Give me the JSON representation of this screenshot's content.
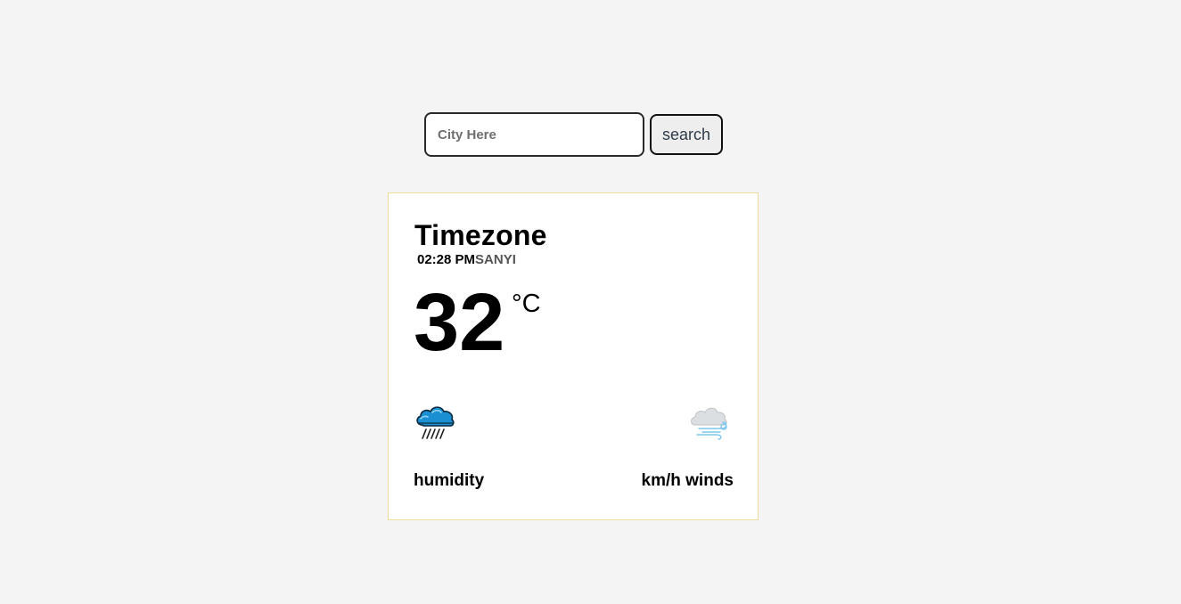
{
  "search": {
    "placeholder": "City Here",
    "value": "",
    "button_label": "search"
  },
  "card": {
    "title": "Timezone",
    "time": "02:28 PM",
    "timezone_abbr": "SANYI",
    "temperature": "32",
    "unit": "°C",
    "weather_icon": "rain-cloud-icon",
    "wind_icon": "wind-cloud-icon",
    "humidity_label": "humidity",
    "winds_label": "km/h winds"
  },
  "colors": {
    "page_background": "#f4f4f4",
    "card_background": "#ffffff",
    "card_border": "#f0dc9c",
    "rain_cloud": "#1a8fd1",
    "wind_cloud": "#d6d8da",
    "wind_lines": "#7cc7ee"
  }
}
